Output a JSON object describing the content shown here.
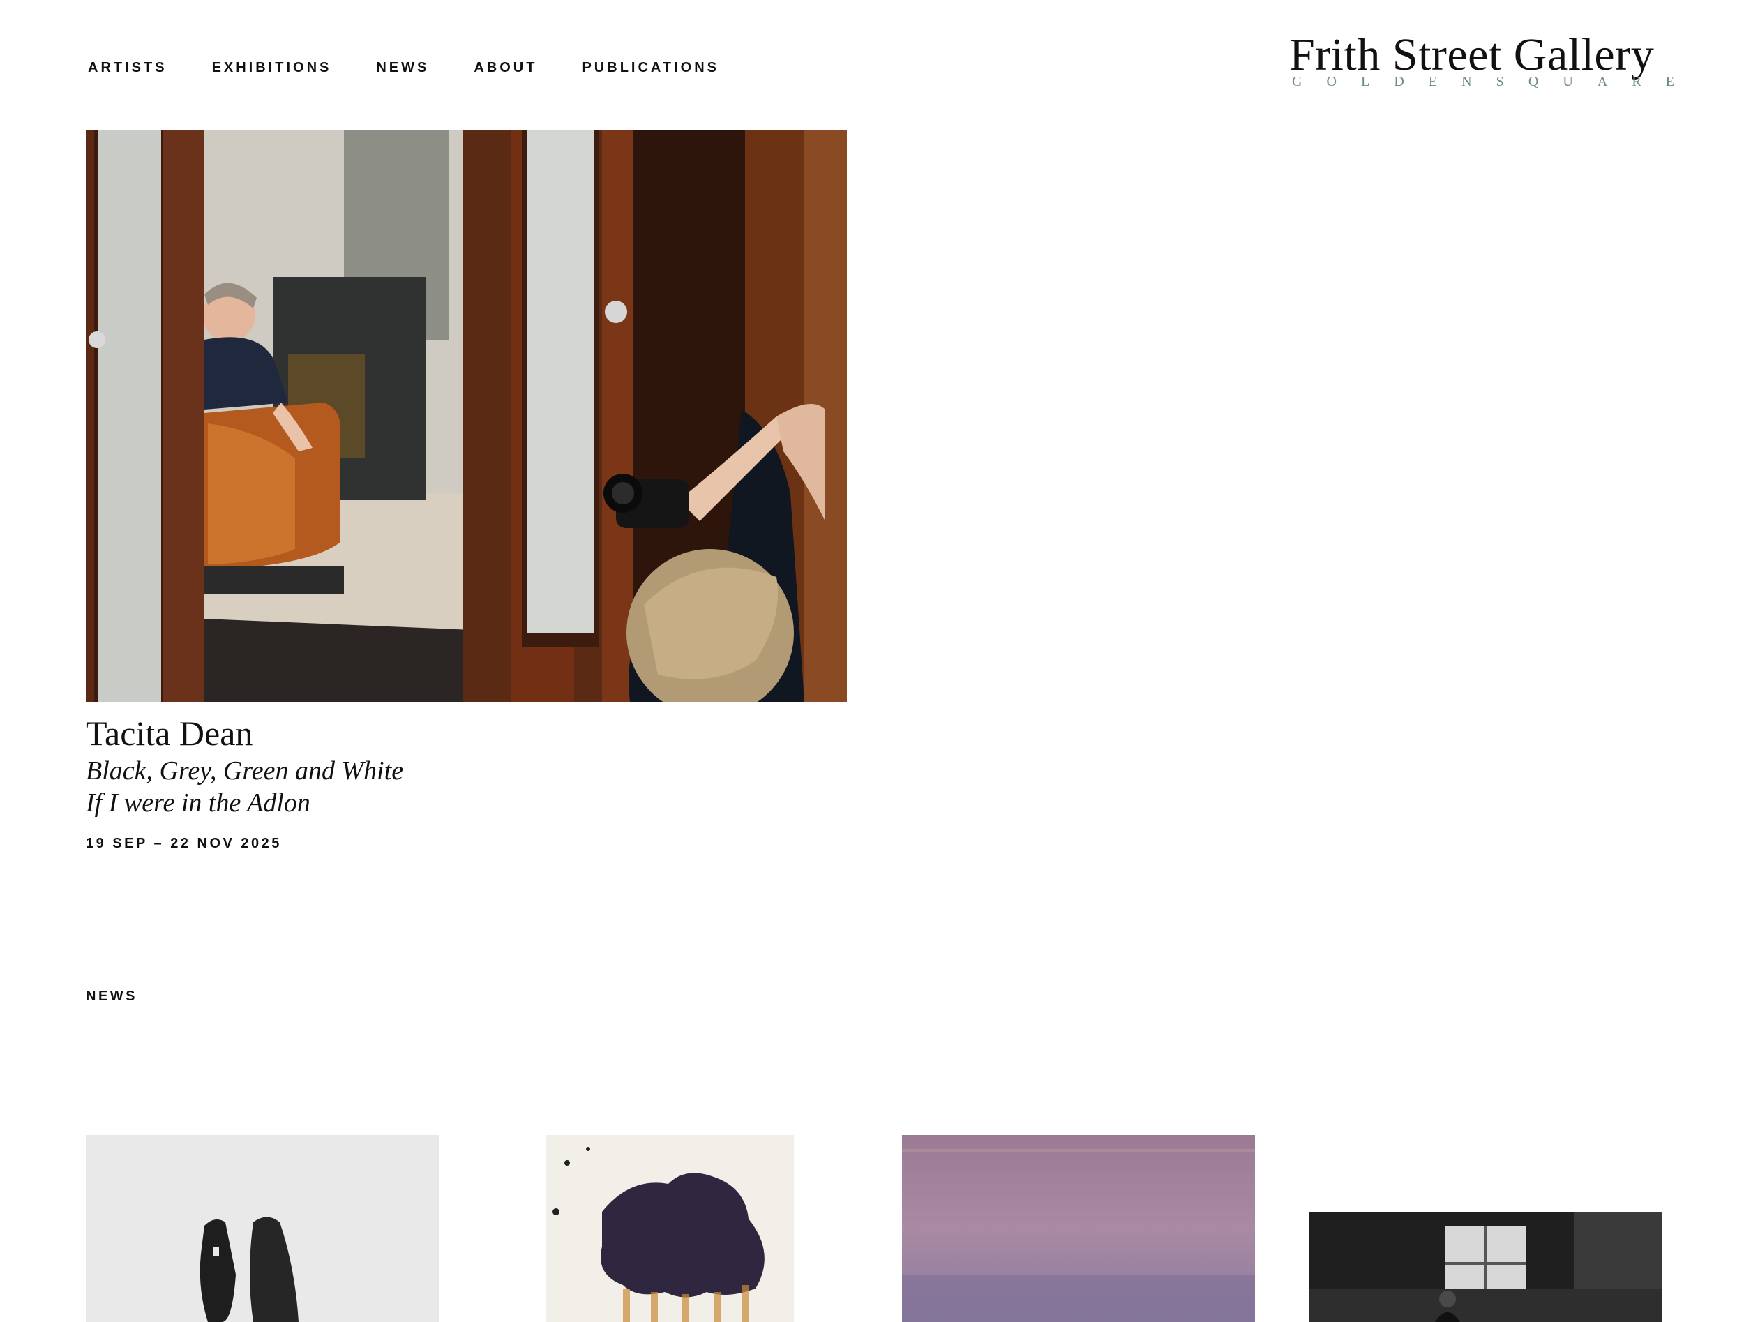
{
  "nav": {
    "items": [
      {
        "label": "ARTISTS"
      },
      {
        "label": "EXHIBITIONS"
      },
      {
        "label": "NEWS"
      },
      {
        "label": "ABOUT"
      },
      {
        "label": "PUBLICATIONS"
      }
    ]
  },
  "logo": {
    "name": "Frith Street Gallery",
    "subtitle_letters": [
      "G",
      "O",
      "L",
      "D",
      "E",
      "N",
      " ",
      "S",
      "Q",
      "U",
      "A",
      "R",
      "E"
    ]
  },
  "feature": {
    "artist": "Tacita Dean",
    "title_line_1": "Black, Grey, Green and White",
    "title_line_2": "If I were in the Adlon",
    "dates": "19 SEP – 22 NOV 2025"
  },
  "news": {
    "heading": "NEWS"
  },
  "colors": {
    "text": "#111111",
    "logo_subtitle": "#6e8a86",
    "background": "#ffffff"
  }
}
